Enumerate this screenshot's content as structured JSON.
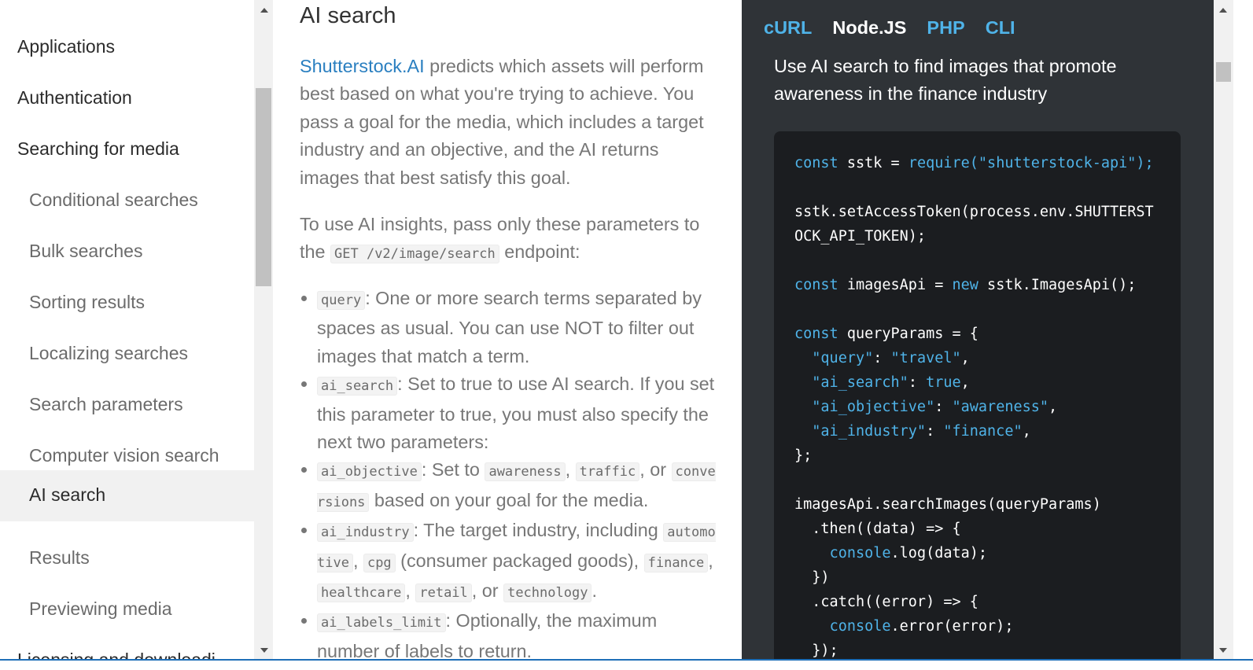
{
  "sidebar": {
    "items": [
      {
        "label": "Applications",
        "level": "top"
      },
      {
        "label": "Authentication",
        "level": "top"
      },
      {
        "label": "Searching for media",
        "level": "top"
      },
      {
        "label": "Conditional searches",
        "level": "sub"
      },
      {
        "label": "Bulk searches",
        "level": "sub"
      },
      {
        "label": "Sorting results",
        "level": "sub"
      },
      {
        "label": "Localizing searches",
        "level": "sub"
      },
      {
        "label": "Search parameters",
        "level": "sub"
      },
      {
        "label": "Computer vision search",
        "level": "sub"
      },
      {
        "label": "AI search",
        "level": "sub",
        "active": true
      },
      {
        "label": "Results",
        "level": "sub"
      },
      {
        "label": "Previewing media",
        "level": "sub"
      },
      {
        "label": "Licensing and downloadi…",
        "level": "top"
      }
    ]
  },
  "content": {
    "title": "AI search",
    "intro": {
      "link": "Shutterstock.AI",
      "text": " predicts which assets will perform best based on what you're trying to achieve. You pass a goal for the media, which includes a target industry and an objective, and the AI returns images that best satisfy this goal."
    },
    "usage": {
      "before": "To use AI insights, pass only these parameters to the ",
      "code": "GET /v2/image/search",
      "after": " endpoint:"
    },
    "params": {
      "query": {
        "code": "query",
        "text": ": One or more search terms separated by spaces as usual. You can use NOT to filter out images that match a term."
      },
      "ai_search": {
        "code": "ai_search",
        "text": ": Set to true to use AI search. If you set this parameter to true, you must also specify the next two parameters:"
      },
      "ai_objective": {
        "code": "ai_objective",
        "text1": ": Set to ",
        "v1": "awareness",
        "sep1": ", ",
        "v2": "traffic",
        "sep2": ", or ",
        "v3": "conversions",
        "text2": " based on your goal for the media."
      },
      "ai_industry": {
        "code": "ai_industry",
        "text1": ": The target industry, including ",
        "v1": "automotive",
        "sep1": ", ",
        "v2": "cpg",
        "text2": " (consumer packaged goods), ",
        "v3": "finance",
        "sep3": ", ",
        "v4": "healthcare",
        "sep4": ", ",
        "v5": "retail",
        "sep5": ", or ",
        "v6": "technology",
        "end": "."
      },
      "ai_labels_limit": {
        "code": "ai_labels_limit",
        "text": ": Optionally, the maximum number of labels to return."
      }
    }
  },
  "codepanel": {
    "tabs": [
      {
        "label": "cURL",
        "active": false
      },
      {
        "label": "Node.JS",
        "active": true
      },
      {
        "label": "PHP",
        "active": false
      },
      {
        "label": "CLI",
        "active": false
      }
    ],
    "description": "Use AI search to find images that promote awareness in the finance industry",
    "code": {
      "const": "const",
      "new": "new",
      "true": "true",
      "sstk": " sstk = ",
      "require": "require",
      "require_arg": "(\"shutterstock-api\");",
      "token_line1": "sstk.setAccessToken(process.env.SHUTTERST",
      "token_line2": "OCK_API_TOKEN);",
      "imagesApi": " imagesApi = ",
      "imagesApi_ctor": " sstk.ImagesApi();",
      "queryParams": " queryParams = {",
      "q_key": "\"query\"",
      "q_val": "\"travel\"",
      "ais_key": "\"ai_search\"",
      "aio_key": "\"ai_objective\"",
      "aio_val": "\"awareness\"",
      "aii_key": "\"ai_industry\"",
      "aii_val": "\"finance\"",
      "close_obj": "};",
      "search_call": "imagesApi.searchImages(queryParams)",
      "then": "  .then((data) => {",
      "console": "console",
      "log": ".log(data);",
      "close_then": "  })",
      "catch": "  .catch((error) => {",
      "err": ".error(error);",
      "close_catch": "  });"
    }
  },
  "colors": {
    "link": "#2a7fc0",
    "code_panel_bg": "#2f3337",
    "code_block_bg": "#1b1d20",
    "code_accent": "#4fb3e8",
    "active_nav_bg": "#f1f1f1"
  }
}
